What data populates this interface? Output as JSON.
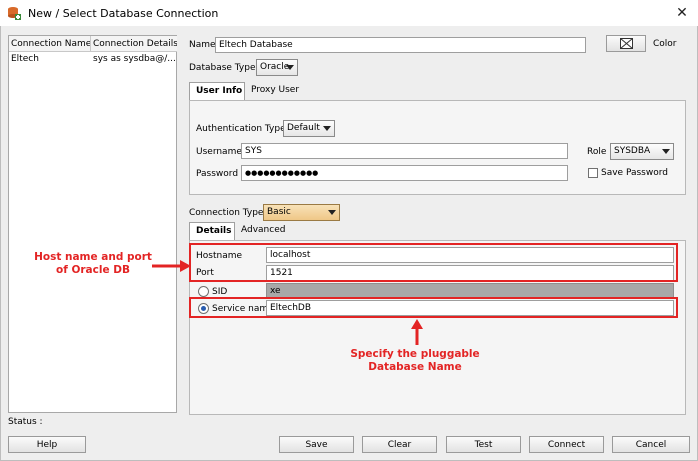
{
  "window": {
    "title": "New / Select Database Connection",
    "close_glyph": "✕"
  },
  "connection_list": {
    "headers": [
      "Connection Name",
      "Connection Details"
    ],
    "rows": [
      {
        "name": "Eltech",
        "details": "sys as sysdba@/..."
      }
    ]
  },
  "form": {
    "name_label": "Name",
    "name_value": "Eltech Database",
    "color_label": "Color",
    "database_type_label": "Database Type",
    "database_type_value": "Oracle",
    "tabs": [
      "User Info",
      "Proxy User"
    ],
    "auth_type_label": "Authentication Type",
    "auth_type_value": "Default",
    "username_label": "Username",
    "username_value": "SYS",
    "role_label": "Role",
    "role_value": "SYSDBA",
    "password_label": "Password",
    "password_value": "●●●●●●●●●●●●",
    "save_password_label": "Save Password",
    "connection_type_label": "Connection Type",
    "connection_type_value": "Basic",
    "detail_tabs": [
      "Details",
      "Advanced"
    ],
    "hostname_label": "Hostname",
    "hostname_value": "localhost",
    "port_label": "Port",
    "port_value": "1521",
    "sid_label": "SID",
    "sid_value": "xe",
    "service_name_label": "Service name",
    "service_name_value": "EltechDB"
  },
  "annotations": {
    "host_port": [
      "Host name and port",
      "of Oracle DB"
    ],
    "service": [
      "Specify the pluggable",
      "Database Name"
    ],
    "color": "#e32424"
  },
  "status_label": "Status :",
  "buttons": {
    "help": "Help",
    "save": "Save",
    "clear": "Clear",
    "test": "Test",
    "connect": "Connect",
    "cancel": "Cancel"
  }
}
